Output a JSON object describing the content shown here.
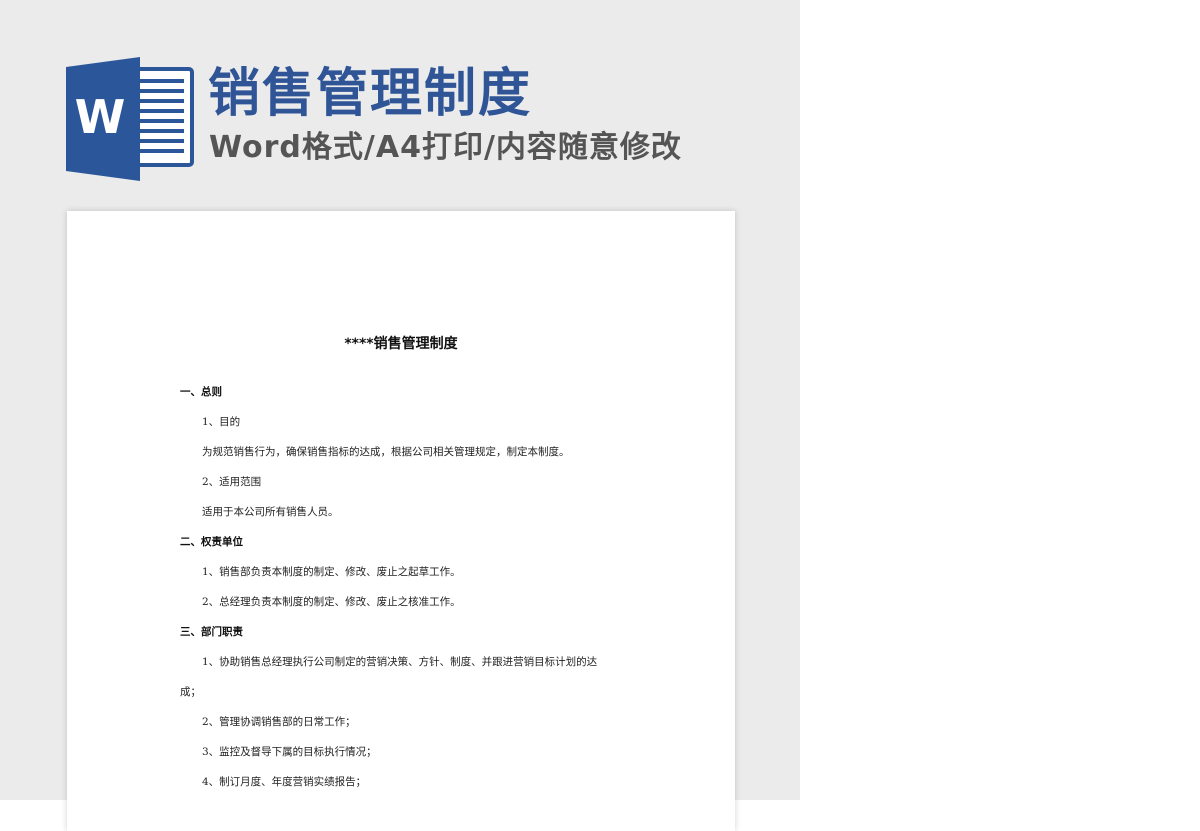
{
  "banner": {
    "logo_letter": "W",
    "title": "销售管理制度",
    "subtitle": "Word格式/A4打印/内容随意修改",
    "title_color": "#2f5597",
    "logo_color": "#2b579a"
  },
  "document": {
    "title": "****销售管理制度",
    "lines": [
      {
        "text": "一、总则",
        "type": "heading"
      },
      {
        "text": "1、目的",
        "type": "body"
      },
      {
        "text": "为规范销售行为，确保销售指标的达成，根据公司相关管理规定，制定本制度。",
        "type": "body"
      },
      {
        "text": "2、适用范围",
        "type": "body"
      },
      {
        "text": "适用于本公司所有销售人员。",
        "type": "body"
      },
      {
        "text": "二、权责单位",
        "type": "heading"
      },
      {
        "text": "1、销售部负责本制度的制定、修改、废止之起草工作。",
        "type": "body"
      },
      {
        "text": "2、总经理负责本制度的制定、修改、废止之核准工作。",
        "type": "body"
      },
      {
        "text": "三、部门职责",
        "type": "heading"
      },
      {
        "text": "1、协助销售总经理执行公司制定的营销决策、方针、制度、并跟进营销目标计划的达",
        "type": "body"
      },
      {
        "text": "成；",
        "type": "wrap"
      },
      {
        "text": "2、管理协调销售部的日常工作；",
        "type": "body"
      },
      {
        "text": "3、监控及督导下属的目标执行情况；",
        "type": "body"
      },
      {
        "text": "4、制订月度、年度营销实绩报告；",
        "type": "body"
      }
    ]
  }
}
